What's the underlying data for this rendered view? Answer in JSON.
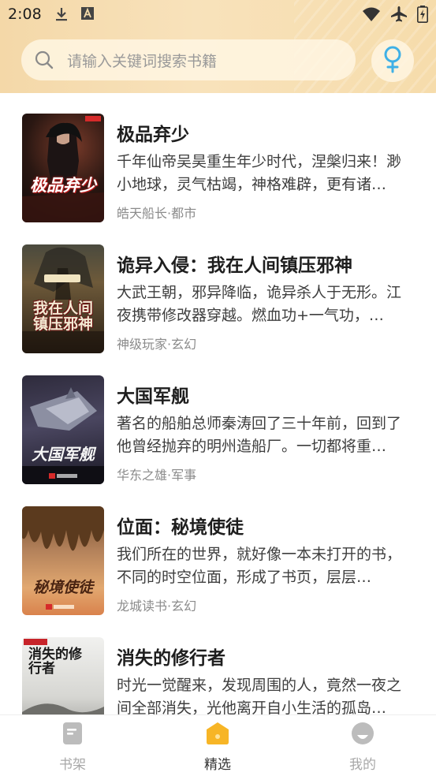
{
  "status_bar": {
    "time": "2:08",
    "left_icons": [
      "download-icon",
      "a-letter-icon"
    ],
    "right_icons": [
      "wifi-icon",
      "airplane-mode-icon",
      "battery-charging-icon"
    ]
  },
  "search": {
    "placeholder": "请输入关键词搜索书籍",
    "icon": "search-icon"
  },
  "gender_toggle": {
    "icon": "female-symbol-icon",
    "color": "#3fb0e6"
  },
  "books": [
    {
      "title": "极品弃少",
      "description": "千年仙帝吴昊重生年少时代，涅槃归来！渺小地球，灵气枯竭，神格难辟，更有诸…",
      "author": "皓天船长",
      "category": "都市",
      "meta": "皓天船长·都市",
      "cover_text": "极品弃少"
    },
    {
      "title": "诡异入侵：我在人间镇压邪神",
      "description": "大武王朝，邪异降临，诡异杀人于无形。江夜携带修改器穿越。燃血功+一气功，…",
      "author": "神级玩家",
      "category": "玄幻",
      "meta": "神级玩家·玄幻",
      "cover_text": "我在人间镇压邪神"
    },
    {
      "title": "大国军舰",
      "description": "著名的船舶总师秦涛回了三十年前，回到了他曾经抛弃的明州造船厂。一切都将重…",
      "author": "华东之雄",
      "category": "军事",
      "meta": "华东之雄·军事",
      "cover_text": "大国军舰"
    },
    {
      "title": "位面：秘境使徒",
      "description": "我们所在的世界，就好像一本未打开的书，不同的时空位面，形成了书页，层层…",
      "author": "龙城读书",
      "category": "玄幻",
      "meta": "龙城读书·玄幻",
      "cover_text": "秘境使徒"
    },
    {
      "title": "消失的修行者",
      "description": "时光一觉醒来，发现周围的人，竟然一夜之间全部消失，光他离开自小生活的孤岛…",
      "author": "",
      "category": "",
      "meta": "",
      "cover_text": "消失的修行者"
    }
  ],
  "tabs": [
    {
      "label": "书架",
      "icon": "bookshelf-icon",
      "active": false
    },
    {
      "label": "精选",
      "icon": "featured-house-icon",
      "active": true
    },
    {
      "label": "我的",
      "icon": "profile-icon",
      "active": false
    }
  ],
  "colors": {
    "header_gradient": "#f6dcab",
    "active_tab_icon": "#f7b526",
    "inactive_tab_icon": "#bcbcbc"
  }
}
